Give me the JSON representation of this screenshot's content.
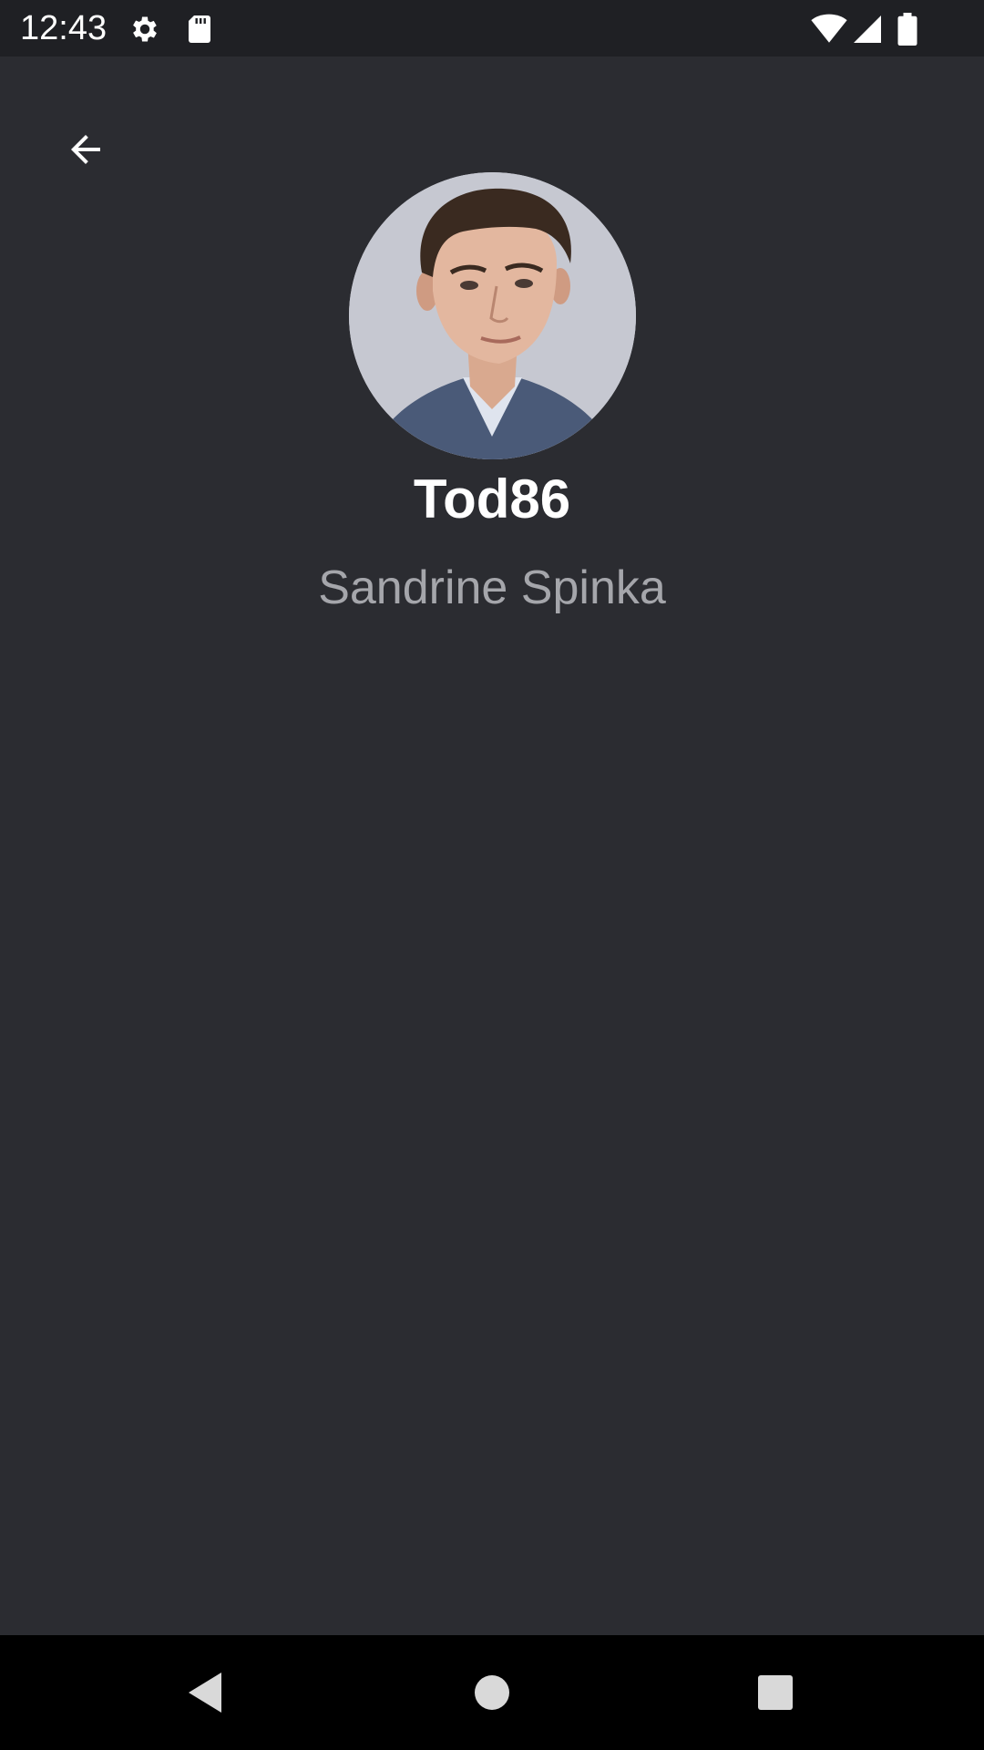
{
  "status_bar": {
    "time": "12:43",
    "icons_left": [
      "gear-icon",
      "sd-card-icon"
    ],
    "icons_right": [
      "wifi-icon",
      "signal-icon",
      "battery-icon"
    ]
  },
  "toolbar": {
    "back_icon": "arrow-back-icon"
  },
  "profile": {
    "username": "Tod86",
    "full_name": "Sandrine Spinka",
    "avatar": "profile-photo"
  },
  "nav_bar": {
    "buttons": [
      "back-triangle-icon",
      "home-circle-icon",
      "recents-square-icon"
    ]
  },
  "colors": {
    "background": "#2b2c31",
    "status_bar": "#1f2024",
    "nav_bar": "#000000",
    "username_text": "#ffffff",
    "full_name_text": "#a5a6ab"
  }
}
